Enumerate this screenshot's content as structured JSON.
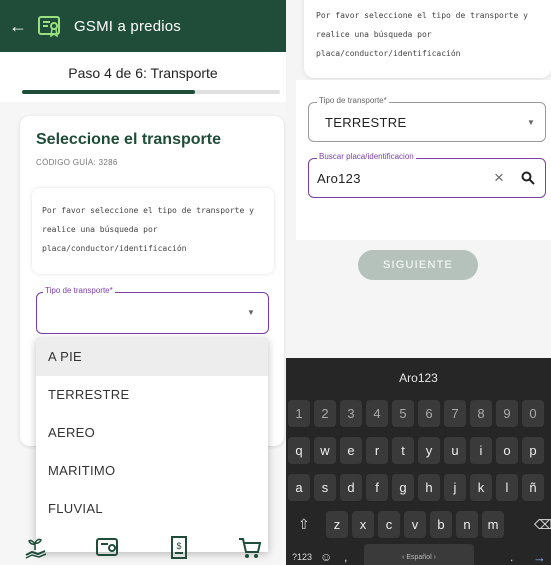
{
  "left_screen": {
    "appbar": {
      "title": "GSMI a predios",
      "back_icon": "arrow-left-icon",
      "logo_icon": "certificate-icon",
      "background": "#1f4d39"
    },
    "step_label": "Paso 4 de 6: Transporte",
    "progress_fraction": 0.67,
    "card": {
      "title": "Seleccione el transporte",
      "guide_code": "CÓDIGO GUÍA: 3286",
      "instruction_line1": "Por favor seleccione el tipo de transporte y",
      "instruction_line2": "realice una búsqueda por",
      "instruction_line3": "placa/conductor/identificación",
      "transport_field_label": "Tipo de transporte*",
      "transport_field_value": ""
    },
    "dropdown_options": [
      "A PIE",
      "TERRESTRE",
      "AEREO",
      "MARITIMO",
      "FLUVIAL"
    ],
    "bottom_nav_icons": [
      "hand-plant-icon",
      "certificate-icon",
      "receipt-icon",
      "cart-icon"
    ]
  },
  "right_screen": {
    "instruction_line1": "Por favor seleccione el tipo de transporte y",
    "instruction_line2": "realice una búsqueda por",
    "instruction_line3": "placa/conductor/identificación",
    "transport_label": "Tipo de transporte*",
    "transport_value": "TERRESTRE",
    "search_label": "Buscar placa/identificacion",
    "search_value": "Aro123",
    "next_button": "SIGUIENTE",
    "keyboard": {
      "suggestion": "Aro123",
      "row_numbers": [
        "1",
        "2",
        "3",
        "4",
        "5",
        "6",
        "7",
        "8",
        "9",
        "0"
      ],
      "row_top": [
        "q",
        "w",
        "e",
        "r",
        "t",
        "y",
        "u",
        "i",
        "o",
        "p"
      ],
      "row_mid": [
        "a",
        "s",
        "d",
        "f",
        "g",
        "h",
        "j",
        "k",
        "l",
        "ñ"
      ],
      "row_bottom": [
        "z",
        "x",
        "c",
        "v",
        "b",
        "n",
        "m"
      ],
      "symbols_key": "?123",
      "comma_key": ",",
      "space_label": "‹ Español ›",
      "period_key": "."
    }
  },
  "colors": {
    "primary": "#1f4d39",
    "accent_purple": "#7a3fa8",
    "button_disabled": "#b4c2bb"
  }
}
